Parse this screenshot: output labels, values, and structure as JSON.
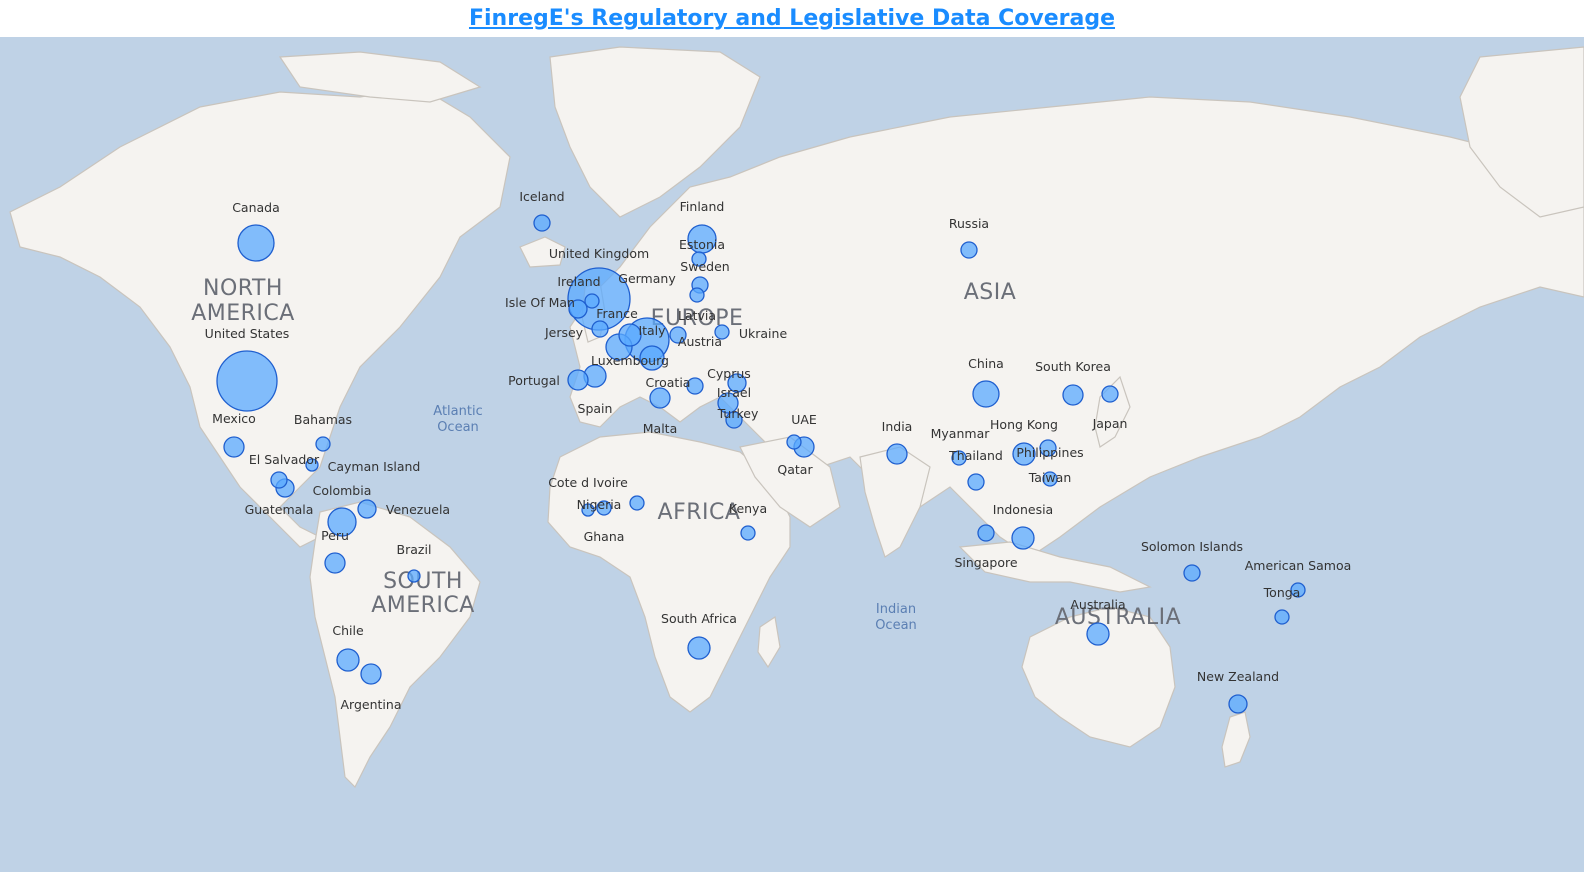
{
  "title": "FinregE's Regulatory and Legislative Data Coverage",
  "continents": [
    "NORTH AMERICA",
    "SOUTH AMERICA",
    "EUROPE",
    "AFRICA",
    "ASIA",
    "AUSTRALIA"
  ],
  "oceans": [
    "Atlantic Ocean",
    "Indian Ocean"
  ],
  "locations": [
    {
      "name": "Canada"
    },
    {
      "name": "United States"
    },
    {
      "name": "Mexico"
    },
    {
      "name": "Bahamas"
    },
    {
      "name": "El Salvador"
    },
    {
      "name": "Cayman Island"
    },
    {
      "name": "Guatemala"
    },
    {
      "name": "Colombia"
    },
    {
      "name": "Venezuela"
    },
    {
      "name": "Peru"
    },
    {
      "name": "Brazil"
    },
    {
      "name": "Chile"
    },
    {
      "name": "Argentina"
    },
    {
      "name": "Iceland"
    },
    {
      "name": "Finland"
    },
    {
      "name": "Estonia"
    },
    {
      "name": "Sweden"
    },
    {
      "name": "United Kingdom"
    },
    {
      "name": "Germany"
    },
    {
      "name": "Ireland"
    },
    {
      "name": "Isle Of Man"
    },
    {
      "name": "Jersey"
    },
    {
      "name": "France"
    },
    {
      "name": "Italy"
    },
    {
      "name": "Latvia"
    },
    {
      "name": "Austria"
    },
    {
      "name": "Ukraine"
    },
    {
      "name": "Luxembourg"
    },
    {
      "name": "Portugal"
    },
    {
      "name": "Spain"
    },
    {
      "name": "Croatia"
    },
    {
      "name": "Cyprus"
    },
    {
      "name": "Israel"
    },
    {
      "name": "Turkey"
    },
    {
      "name": "Malta"
    },
    {
      "name": "Russia"
    },
    {
      "name": "China"
    },
    {
      "name": "South Korea"
    },
    {
      "name": "Japan"
    },
    {
      "name": "India"
    },
    {
      "name": "Myanmar"
    },
    {
      "name": "Hong Kong"
    },
    {
      "name": "Thailand"
    },
    {
      "name": "Philippines"
    },
    {
      "name": "Taiwan"
    },
    {
      "name": "UAE"
    },
    {
      "name": "Qatar"
    },
    {
      "name": "Indonesia"
    },
    {
      "name": "Singapore"
    },
    {
      "name": "Cote d Ivoire"
    },
    {
      "name": "Nigeria"
    },
    {
      "name": "Ghana"
    },
    {
      "name": "Kenya"
    },
    {
      "name": "South Africa"
    },
    {
      "name": "Solomon Islands"
    },
    {
      "name": "American Samoa"
    },
    {
      "name": "Tonga"
    },
    {
      "name": "Australia"
    },
    {
      "name": "New Zealand"
    }
  ]
}
